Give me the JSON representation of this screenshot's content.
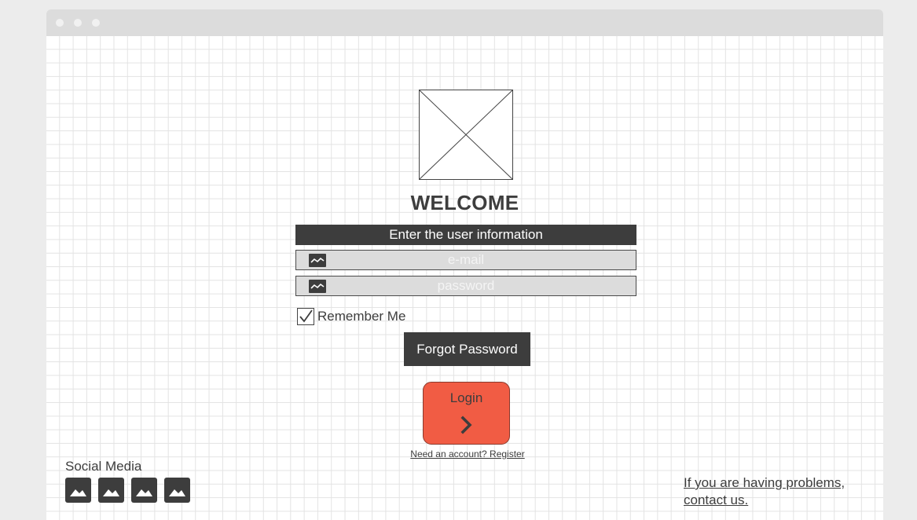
{
  "window": {
    "title": ""
  },
  "welcome": "WELCOME",
  "form": {
    "header": "Enter the user information",
    "email": {
      "placeholder": "e-mail",
      "icon": "image-placeholder-icon"
    },
    "password": {
      "placeholder": "password",
      "icon": "image-placeholder-icon"
    },
    "remember_label": "Remember Me",
    "remember_checked": true,
    "forgot_label": "Forgot Password",
    "login_label": "Login",
    "register_link": "Need an account? Register"
  },
  "social": {
    "label": "Social Media",
    "icons": [
      "image-icon",
      "image-icon",
      "image-icon",
      "image-icon"
    ]
  },
  "help": {
    "line1": "If you are having problems,",
    "line2": "contact us."
  },
  "colors": {
    "dark": "#3d3d3d",
    "login": "#f15c44",
    "field_bg": "#dcdcdc"
  }
}
